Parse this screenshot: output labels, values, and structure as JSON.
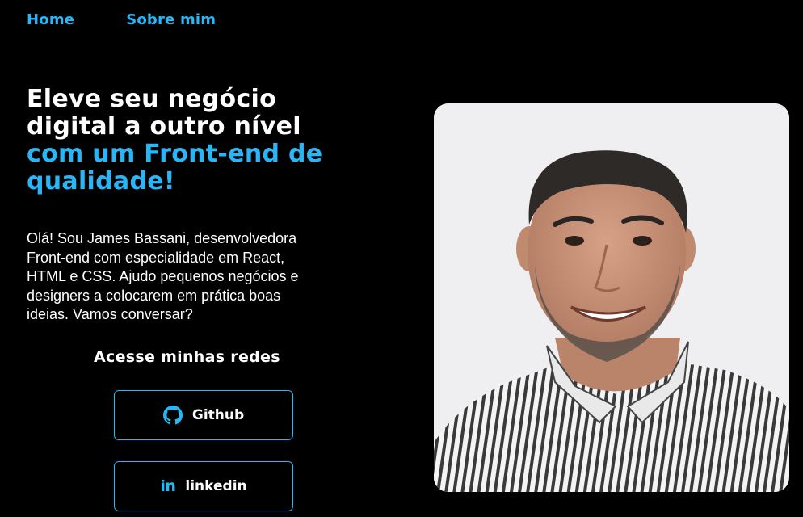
{
  "nav": {
    "home": "Home",
    "about": "Sobre mim"
  },
  "hero": {
    "headline_white_1": "Eleve seu negócio",
    "headline_white_2": "digital a outro nível",
    "headline_blue_1": "com um Front-end de",
    "headline_blue_2": "qualidade!",
    "intro_lines": [
      "Olá! Sou James Bassani, desenvolvedora",
      "Front-end com especialidade em React,",
      "HTML e CSS. Ajudo pequenos negócios e",
      "designers a colocarem em prática boas",
      "ideias. Vamos conversar?"
    ]
  },
  "social": {
    "title": "Acesse minhas redes",
    "github_label": "Github",
    "github_icon": "github-icon",
    "linkedin_label": "linkedin",
    "linkedin_icon": "linkedin-icon",
    "linkedin_glyph": "in"
  },
  "photo": {
    "subject": "profile-photo"
  },
  "colors": {
    "background": "#000000",
    "accent": "#29b6f6",
    "text": "#ffffff"
  }
}
